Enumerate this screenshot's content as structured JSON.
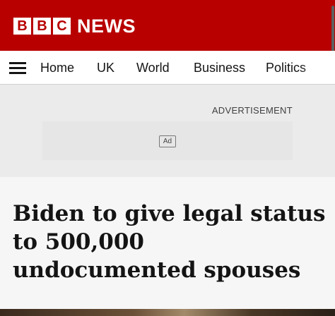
{
  "brand": {
    "blocks": [
      "B",
      "B",
      "C"
    ],
    "name": "NEWS",
    "color": "#b80000"
  },
  "nav": {
    "menu_icon": "hamburger-menu-icon",
    "items": [
      "Home",
      "UK",
      "World",
      "Business",
      "Politics"
    ]
  },
  "ad": {
    "label": "ADVERTISEMENT",
    "badge": "Ad"
  },
  "article": {
    "headline": "Biden to give legal status to 500,000 undocumented spouses"
  }
}
